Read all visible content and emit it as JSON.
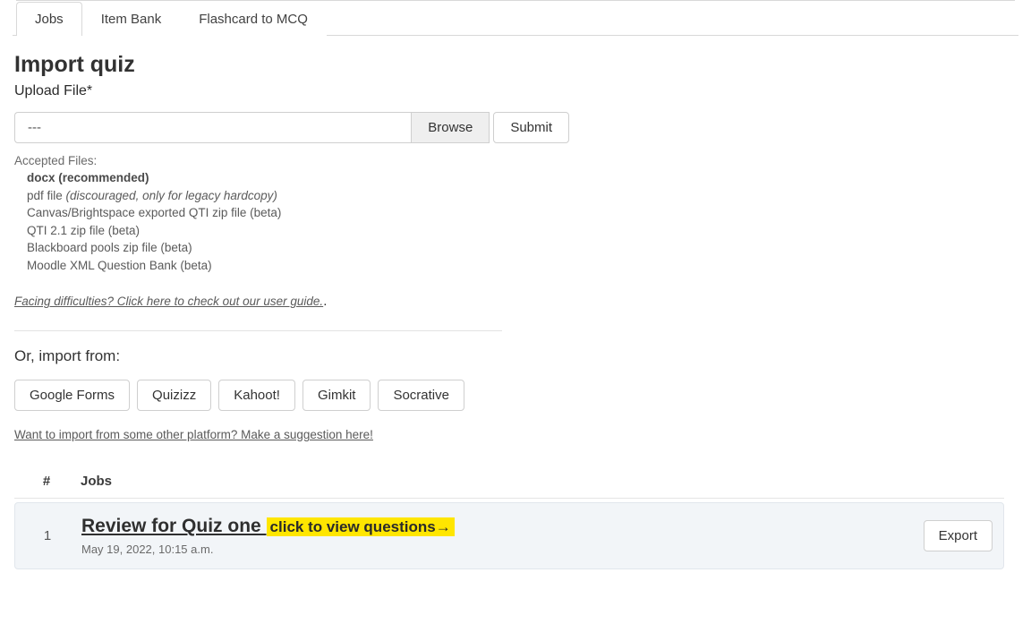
{
  "tabs": [
    {
      "label": "Jobs"
    },
    {
      "label": "Item Bank"
    },
    {
      "label": "Flashcard to MCQ"
    }
  ],
  "title": "Import quiz",
  "upload_label": "Upload File*",
  "file_value": "---",
  "browse_label": "Browse",
  "submit_label": "Submit",
  "accepted_label": "Accepted Files:",
  "accepted": {
    "docx_bold": "docx (recommended)",
    "pdf_prefix": "pdf file ",
    "pdf_ital": "(discouraged, only for legacy hardcopy)",
    "qti_canvas": "Canvas/Brightspace exported QTI zip file (beta)",
    "qti21": "QTI 2.1 zip file (beta)",
    "blackboard": "Blackboard pools zip file (beta)",
    "moodle": "Moodle XML Question Bank (beta)"
  },
  "guide_link": "Facing difficulties? Click here to check out our user guide.",
  "guide_link_suffix": ".",
  "import_from_label": "Or, import from:",
  "platforms": [
    "Google Forms",
    "Quizizz",
    "Kahoot!",
    "Gimkit",
    "Socrative"
  ],
  "suggest_link": "Want to import from some other platform? Make a suggestion here!",
  "table": {
    "col_num": "#",
    "col_jobs": "Jobs"
  },
  "jobs": [
    {
      "num": "1",
      "title": "Review for Quiz one ",
      "hint": "click to view questions→",
      "date": "May 19, 2022, 10:15 a.m.",
      "export_label": "Export"
    }
  ]
}
